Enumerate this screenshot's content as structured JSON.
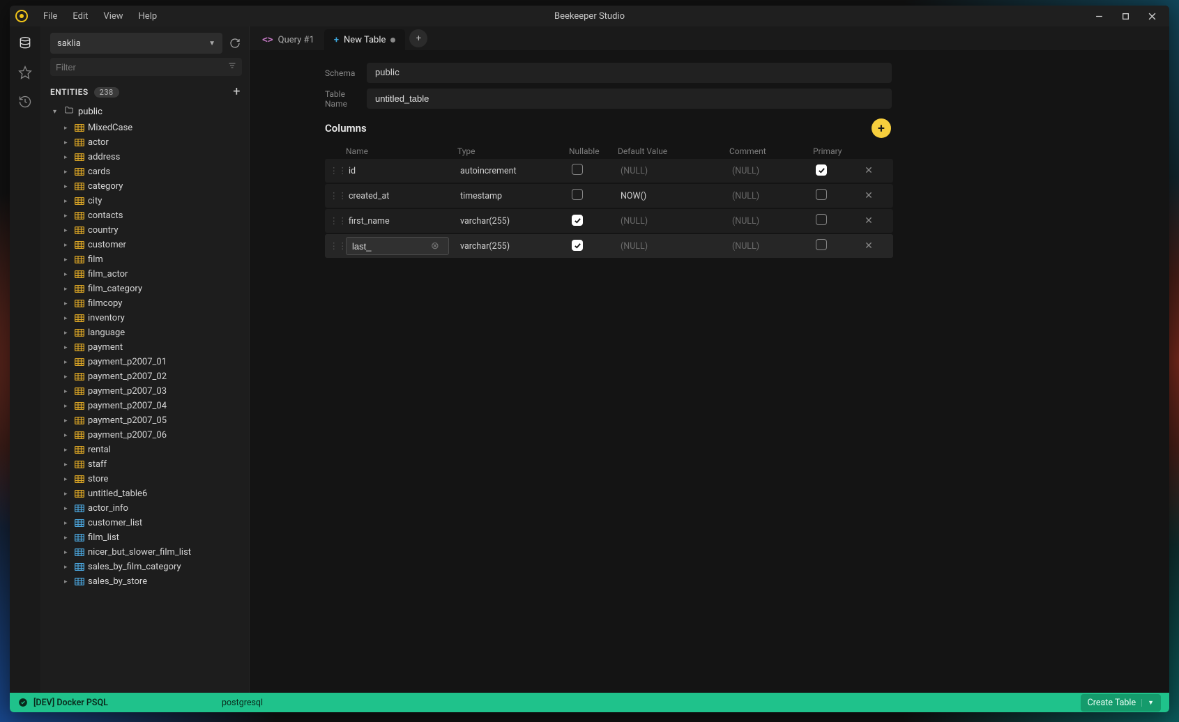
{
  "appTitle": "Beekeeper Studio",
  "menu": [
    "File",
    "Edit",
    "View",
    "Help"
  ],
  "connection": {
    "selected": "saklia"
  },
  "filter": {
    "placeholder": "Filter"
  },
  "entities": {
    "label": "ENTITIES",
    "count": "238"
  },
  "schema": {
    "name": "public"
  },
  "tables": [
    {
      "name": "MixedCase",
      "kind": "yellow"
    },
    {
      "name": "actor",
      "kind": "yellow"
    },
    {
      "name": "address",
      "kind": "yellow"
    },
    {
      "name": "cards",
      "kind": "yellow"
    },
    {
      "name": "category",
      "kind": "yellow"
    },
    {
      "name": "city",
      "kind": "yellow"
    },
    {
      "name": "contacts",
      "kind": "yellow"
    },
    {
      "name": "country",
      "kind": "yellow"
    },
    {
      "name": "customer",
      "kind": "yellow"
    },
    {
      "name": "film",
      "kind": "yellow"
    },
    {
      "name": "film_actor",
      "kind": "yellow"
    },
    {
      "name": "film_category",
      "kind": "yellow"
    },
    {
      "name": "filmcopy",
      "kind": "yellow"
    },
    {
      "name": "inventory",
      "kind": "yellow"
    },
    {
      "name": "language",
      "kind": "yellow"
    },
    {
      "name": "payment",
      "kind": "yellow"
    },
    {
      "name": "payment_p2007_01",
      "kind": "yellow"
    },
    {
      "name": "payment_p2007_02",
      "kind": "yellow"
    },
    {
      "name": "payment_p2007_03",
      "kind": "yellow"
    },
    {
      "name": "payment_p2007_04",
      "kind": "yellow"
    },
    {
      "name": "payment_p2007_05",
      "kind": "yellow"
    },
    {
      "name": "payment_p2007_06",
      "kind": "yellow"
    },
    {
      "name": "rental",
      "kind": "yellow"
    },
    {
      "name": "staff",
      "kind": "yellow"
    },
    {
      "name": "store",
      "kind": "yellow"
    },
    {
      "name": "untitled_table6",
      "kind": "yellow"
    },
    {
      "name": "actor_info",
      "kind": "blue"
    },
    {
      "name": "customer_list",
      "kind": "blue"
    },
    {
      "name": "film_list",
      "kind": "blue"
    },
    {
      "name": "nicer_but_slower_film_list",
      "kind": "blue"
    },
    {
      "name": "sales_by_film_category",
      "kind": "blue"
    },
    {
      "name": "sales_by_store",
      "kind": "blue"
    }
  ],
  "tabs": [
    {
      "label": "Query #1",
      "icon": "code",
      "active": false
    },
    {
      "label": "New Table",
      "icon": "plus",
      "active": true,
      "dirty": true
    }
  ],
  "form": {
    "schemaLabel": "Schema",
    "schemaValue": "public",
    "tableNameLabel": "Table Name",
    "tableNameValue": "untitled_table"
  },
  "columnsHeading": "Columns",
  "colHeaders": {
    "name": "Name",
    "type": "Type",
    "nullable": "Nullable",
    "default": "Default Value",
    "comment": "Comment",
    "primary": "Primary"
  },
  "columns": [
    {
      "name": "id",
      "type": "autoincrement",
      "nullable": false,
      "default": "(NULL)",
      "defaultNull": true,
      "comment": "(NULL)",
      "primary": true,
      "editing": false
    },
    {
      "name": "created_at",
      "type": "timestamp",
      "nullable": false,
      "default": "NOW()",
      "defaultNull": false,
      "comment": "(NULL)",
      "primary": false,
      "editing": false
    },
    {
      "name": "first_name",
      "type": "varchar(255)",
      "nullable": true,
      "default": "(NULL)",
      "defaultNull": true,
      "comment": "(NULL)",
      "primary": false,
      "editing": false
    },
    {
      "name": "last_",
      "type": "varchar(255)",
      "nullable": true,
      "default": "(NULL)",
      "defaultNull": true,
      "comment": "(NULL)",
      "primary": false,
      "editing": true
    }
  ],
  "status": {
    "connection": "[DEV] Docker PSQL",
    "driver": "postgresql",
    "primaryAction": "Create Table"
  }
}
